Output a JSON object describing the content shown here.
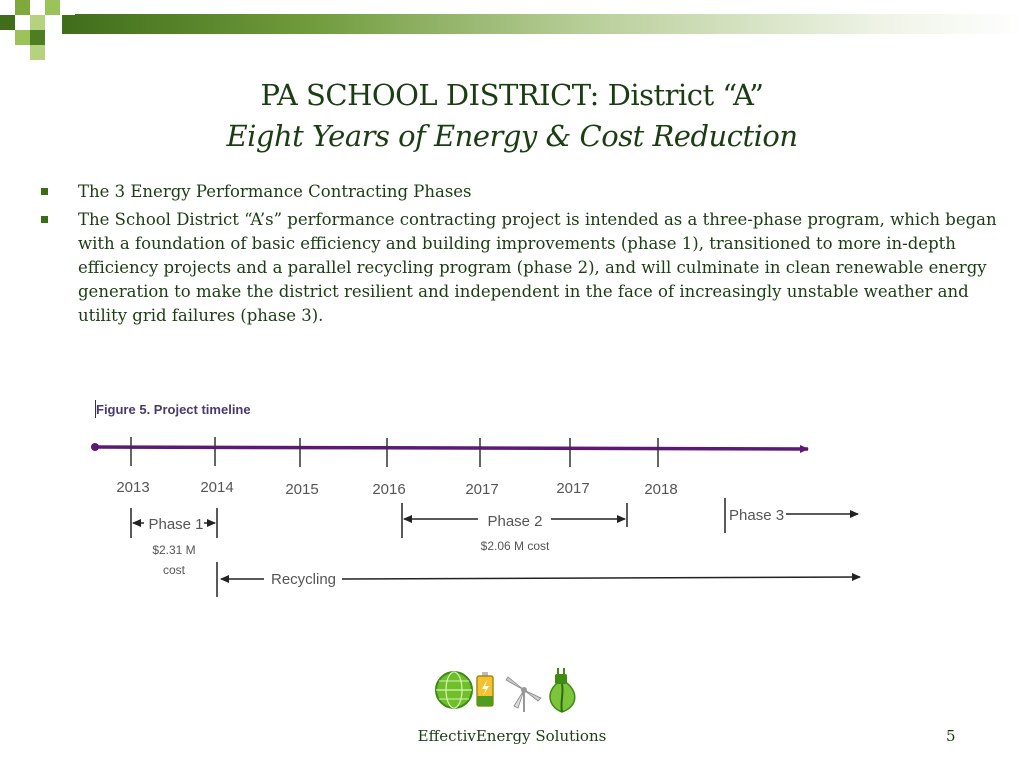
{
  "header": {
    "title": "PA SCHOOL DISTRICT: District “A”",
    "subtitle": "Eight Years of Energy & Cost Reduction"
  },
  "bullets": [
    "The 3 Energy Performance Contracting Phases",
    "The School District “A’s” performance contracting project is intended as a three-phase program, which began with a foundation of basic efficiency and building improvements (phase 1), transitioned to more in-depth efficiency projects and a parallel recycling program (phase 2), and will culminate in clean renewable energy generation to make the district resilient and independent in the face of increasingly unstable weather and utility grid failures (phase 3)."
  ],
  "figure": {
    "caption": "Figure 5. Project timeline",
    "years": [
      "2013",
      "2014",
      "2015",
      "2016",
      "2017",
      "2017",
      "2018"
    ],
    "phase1": {
      "label": "Phase 1",
      "cost_line1": "$2.31 M",
      "cost_line2": "cost"
    },
    "phase2": {
      "label": "Phase 2",
      "cost": "$2.06 M cost"
    },
    "phase3": {
      "label": "Phase 3"
    },
    "recycling": {
      "label": "Recycling"
    },
    "colors": {
      "timeline": "#5c1a74",
      "arrows": "#222222",
      "text": "#555555"
    }
  },
  "footer": {
    "company": "EffectivEnergy Solutions",
    "page_number": "5",
    "logo_icons": [
      "globe-icon",
      "battery-icon",
      "wind-turbine-icon",
      "plug-leaf-icon"
    ]
  }
}
